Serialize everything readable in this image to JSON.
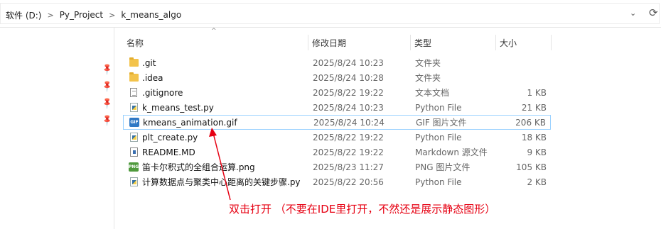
{
  "address_bar": {
    "crumbs": [
      "软件 (D:)",
      "Py_Project",
      "k_means_algo"
    ],
    "separator": ">",
    "dropdown_glyph": "⌄",
    "refresh_glyph": "⟳"
  },
  "columns": {
    "name": "名称",
    "date": "修改日期",
    "type": "类型",
    "size": "大小",
    "sort_glyph": "^"
  },
  "files": [
    {
      "name": ".git",
      "date": "2025/8/24 10:23",
      "type": "文件夹",
      "size": "",
      "icon": "folder-icon"
    },
    {
      "name": ".idea",
      "date": "2025/8/24 10:28",
      "type": "文件夹",
      "size": "",
      "icon": "folder-icon"
    },
    {
      "name": ".gitignore",
      "date": "2025/8/22 19:22",
      "type": "文本文档",
      "size": "1 KB",
      "icon": "text-file-icon"
    },
    {
      "name": "k_means_test.py",
      "date": "2025/8/24 10:23",
      "type": "Python File",
      "size": "21 KB",
      "icon": "python-file-icon"
    },
    {
      "name": "kmeans_animation.gif",
      "date": "2025/8/24 10:24",
      "type": "GIF 图片文件",
      "size": "206 KB",
      "icon": "gif-file-icon",
      "selected": true
    },
    {
      "name": "plt_create.py",
      "date": "2025/8/22 19:22",
      "type": "Python File",
      "size": "18 KB",
      "icon": "python-file-icon"
    },
    {
      "name": "README.MD",
      "date": "2025/8/22 19:22",
      "type": "Markdown 源文件",
      "size": "9 KB",
      "icon": "markdown-file-icon"
    },
    {
      "name": "笛卡尔积式的全组合运算.png",
      "date": "2025/8/23 11:27",
      "type": "PNG 图片文件",
      "size": "105 KB",
      "icon": "png-file-icon"
    },
    {
      "name": "计算数据点与聚类中心距离的关键步骤.py",
      "date": "2025/8/22 20:56",
      "type": "Python File",
      "size": "2 KB",
      "icon": "python-file-icon"
    }
  ],
  "icon_labels": {
    "gif": "GIF",
    "png": "PNG"
  },
  "annotation": {
    "text": "双击打开 （不要在IDE里打开，不然还是展示静态图形）",
    "color": "#e60012"
  },
  "colors": {
    "selection_border": "#99d1ff",
    "folder": "#f3c34b"
  }
}
